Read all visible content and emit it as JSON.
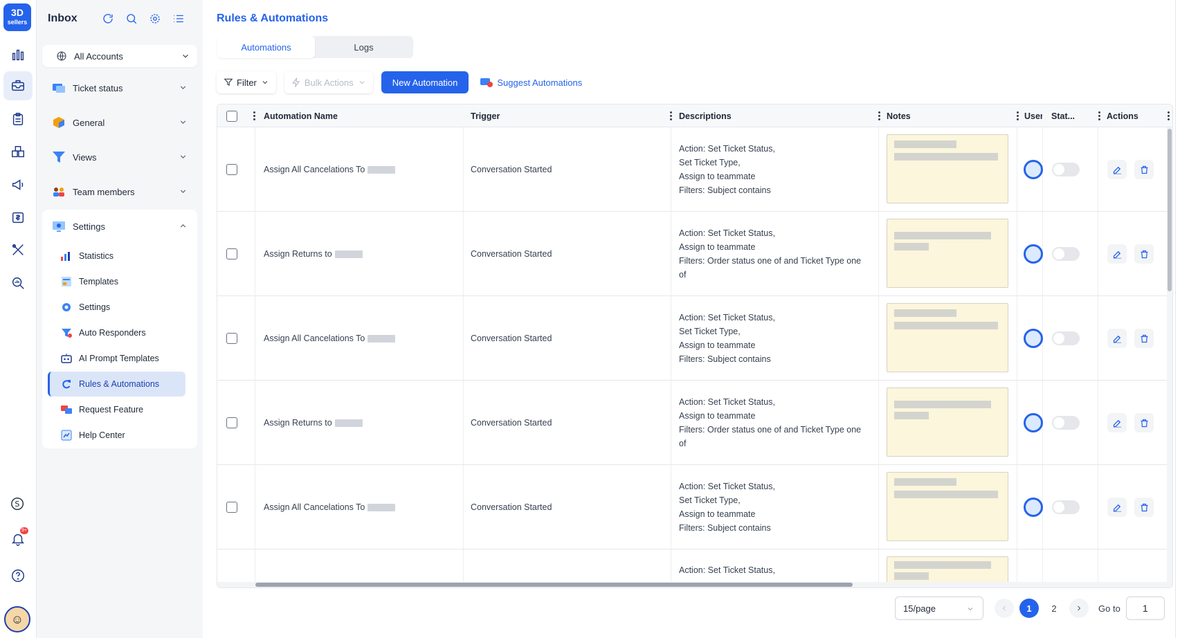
{
  "rail": {
    "logo_line1": "3D",
    "logo_line2": "sellers",
    "notif_count": "9+",
    "items": [
      "analytics-icon",
      "inbox-icon",
      "clipboard-icon",
      "products-icon",
      "megaphone-icon",
      "finance-icon",
      "tools-icon",
      "research-icon"
    ],
    "switch_account_icon": "s-circle-icon",
    "help_icon": "help-icon"
  },
  "sidebar": {
    "title": "Inbox",
    "account_select": "All Accounts",
    "sections": [
      {
        "label": "Ticket status",
        "icon": "ticket-icon"
      },
      {
        "label": "General",
        "icon": "cube-icon"
      },
      {
        "label": "Views",
        "icon": "funnel-icon"
      },
      {
        "label": "Team members",
        "icon": "team-icon"
      },
      {
        "label": "Settings",
        "icon": "settings-monitor-icon"
      }
    ],
    "settings_items": [
      {
        "label": "Statistics",
        "icon": "bar-chart-icon"
      },
      {
        "label": "Templates",
        "icon": "template-icon"
      },
      {
        "label": "Settings",
        "icon": "gear-icon"
      },
      {
        "label": "Auto Responders",
        "icon": "auto-responder-icon"
      },
      {
        "label": "AI Prompt Templates",
        "icon": "robot-icon"
      },
      {
        "label": "Rules & Automations",
        "icon": "automation-icon"
      },
      {
        "label": "Request Feature",
        "icon": "request-icon"
      },
      {
        "label": "Help Center",
        "icon": "help-center-icon"
      }
    ]
  },
  "main": {
    "title": "Rules & Automations",
    "tabs": [
      "Automations",
      "Logs"
    ],
    "toolbar": {
      "filter": "Filter",
      "bulk_actions": "Bulk Actions",
      "new_automation": "New Automation",
      "suggest": "Suggest Automations"
    },
    "table": {
      "headers": [
        "Automation Name",
        "Trigger",
        "Descriptions",
        "Notes",
        "User",
        "Stat...",
        "Actions"
      ],
      "rows": [
        {
          "name": "Assign All Cancelations To",
          "trigger": "Conversation Started",
          "desc": [
            "Action: Set Ticket Status,",
            "Set Ticket Type,",
            "Assign to teammate",
            "Filters: Subject contains"
          ]
        },
        {
          "name": "Assign Returns to",
          "trigger": "Conversation Started",
          "desc": [
            "Action: Set Ticket Status,",
            "Assign to teammate",
            "Filters: Order status one of  and Ticket Type one",
            "of"
          ]
        },
        {
          "name": "Assign All Cancelations To",
          "trigger": "Conversation Started",
          "desc": [
            "Action: Set Ticket Status,",
            "Set Ticket Type,",
            "Assign to teammate",
            "Filters: Subject contains"
          ]
        },
        {
          "name": "Assign Returns to",
          "trigger": "Conversation Started",
          "desc": [
            "Action: Set Ticket Status,",
            "Assign to teammate",
            "Filters: Order status one of  and Ticket Type one",
            "of"
          ]
        },
        {
          "name": "Assign All Cancelations To",
          "trigger": "Conversation Started",
          "desc": [
            "Action: Set Ticket Status,",
            "Set Ticket Type,",
            "Assign to teammate",
            "Filters: Subject contains"
          ]
        },
        {
          "name": "",
          "trigger": "",
          "desc": [
            "Action: Set Ticket Status,",
            "",
            "",
            ""
          ]
        }
      ]
    },
    "pagination": {
      "per_page": "15/page",
      "pages": [
        "1",
        "2"
      ],
      "current": "1",
      "goto_label": "Go to",
      "goto_value": "1"
    }
  },
  "colors": {
    "accent": "#2563eb",
    "note_bg": "#fbf6dc",
    "sidebar_bg": "#f5f6f8"
  }
}
